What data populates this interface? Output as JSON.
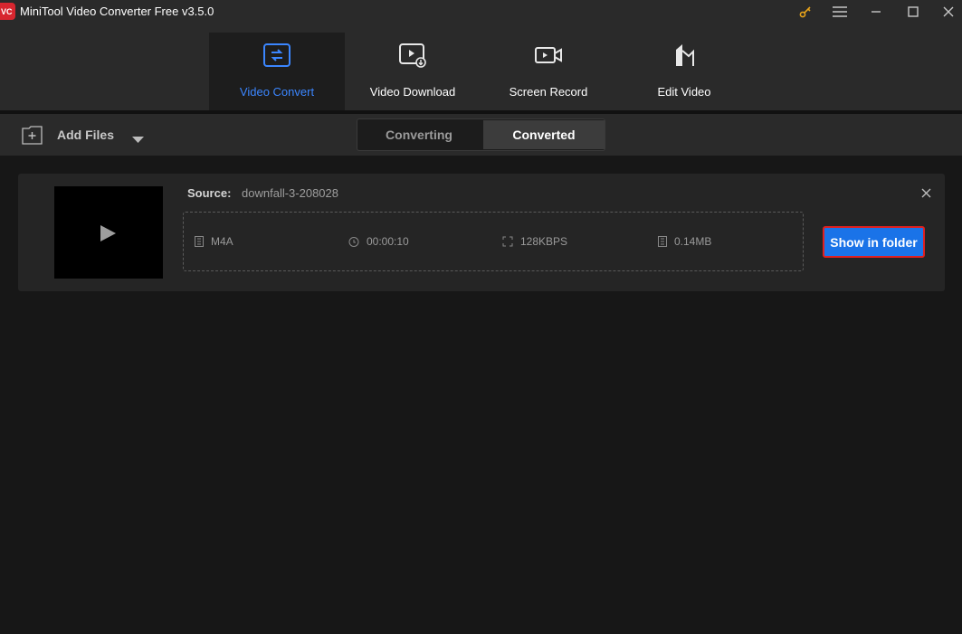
{
  "window": {
    "title": "MiniTool Video Converter Free v3.5.0",
    "logo_text": "VC"
  },
  "nav": {
    "tabs": [
      {
        "label": "Video Convert",
        "icon": "convert-icon",
        "active": true
      },
      {
        "label": "Video Download",
        "icon": "download-icon",
        "active": false
      },
      {
        "label": "Screen Record",
        "icon": "camera-icon",
        "active": false
      },
      {
        "label": "Edit Video",
        "icon": "edit-icon",
        "active": false
      }
    ]
  },
  "toolbar": {
    "add_files_label": "Add Files",
    "segments": [
      {
        "label": "Converting",
        "selected": false
      },
      {
        "label": "Converted",
        "selected": true
      }
    ]
  },
  "item": {
    "source_label": "Source:",
    "source_name": "downfall-3-208028",
    "format": "M4A",
    "duration": "00:00:10",
    "bitrate": "128KBPS",
    "size": "0.14MB",
    "action_label": "Show in folder"
  },
  "colors": {
    "accent": "#3b86ff",
    "button": "#1a73e8",
    "highlight_border": "#e02020",
    "logo": "#d7262f"
  }
}
